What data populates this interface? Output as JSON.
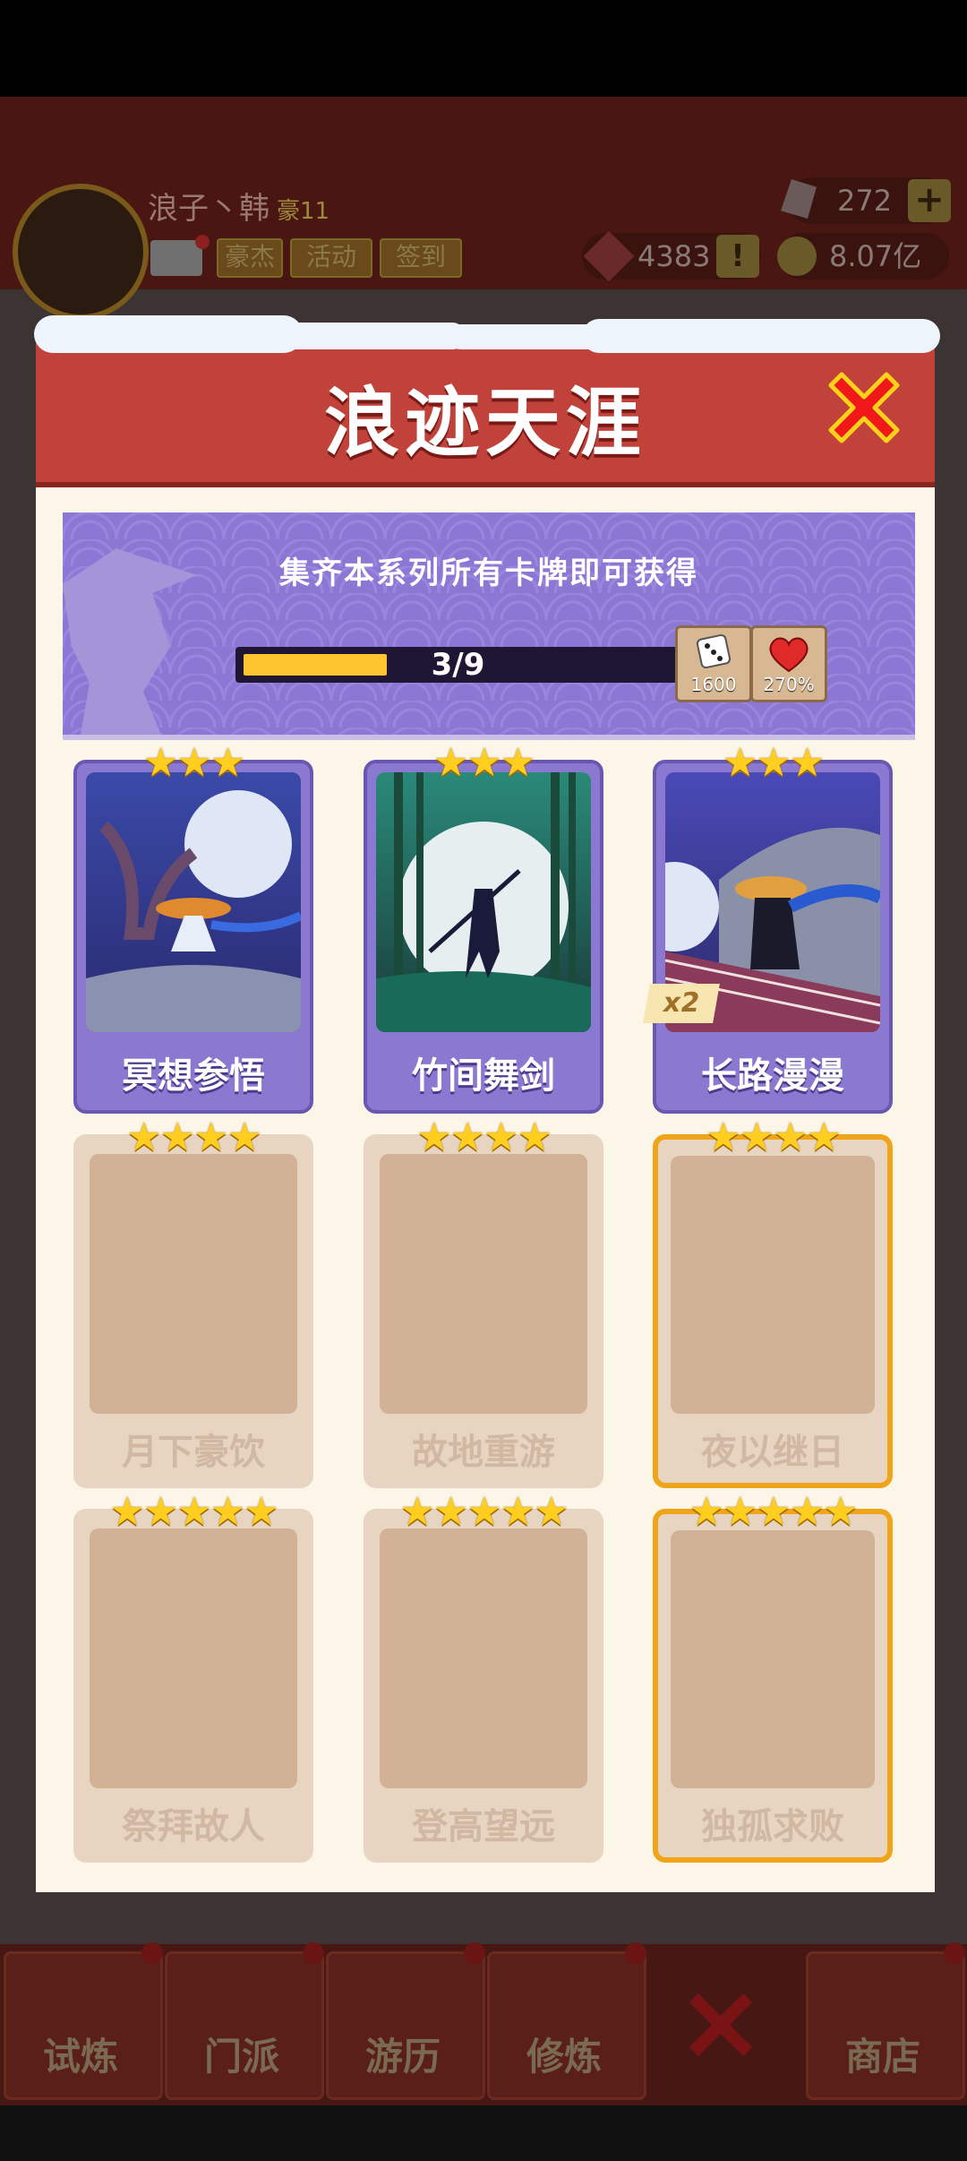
{
  "header": {
    "player_name": "浪子丶韩",
    "rank": "豪11",
    "tabs": [
      "豪杰",
      "活动",
      "签到"
    ],
    "gems": "272",
    "tokens": "4383",
    "coins": "8.07亿"
  },
  "modal": {
    "title": "浪迹天涯",
    "banner_text": "集齐本系列所有卡牌即可获得",
    "progress_text": "3/9",
    "progress": {
      "collected": 3,
      "total": 9
    },
    "rewards": [
      {
        "icon": "dice-icon",
        "label": "1600"
      },
      {
        "icon": "heart-icon",
        "label": "270%"
      }
    ]
  },
  "cards": [
    {
      "name": "冥想参悟",
      "stars": "★★★",
      "owned": true,
      "count_badge": ""
    },
    {
      "name": "竹间舞剑",
      "stars": "★★★",
      "owned": true,
      "count_badge": ""
    },
    {
      "name": "长路漫漫",
      "stars": "★★★",
      "owned": true,
      "count_badge": "x2"
    },
    {
      "name": "月下豪饮",
      "stars": "★★★★",
      "owned": false,
      "gold": false
    },
    {
      "name": "故地重游",
      "stars": "★★★★",
      "owned": false,
      "gold": false
    },
    {
      "name": "夜以继日",
      "stars": "★★★★",
      "owned": false,
      "gold": true
    },
    {
      "name": "祭拜故人",
      "stars": "★★★★★",
      "owned": false,
      "gold": false
    },
    {
      "name": "登高望远",
      "stars": "★★★★★",
      "owned": false,
      "gold": false
    },
    {
      "name": "独孤求败",
      "stars": "★★★★★",
      "owned": false,
      "gold": true
    }
  ],
  "nav": [
    "试炼",
    "门派",
    "游历",
    "修炼",
    "商店"
  ],
  "colors": {
    "accent_red": "#c1423a",
    "banner_purple": "#8c77d4",
    "star_gold": "#ffce1f",
    "progress_fill": "#ffc531"
  }
}
